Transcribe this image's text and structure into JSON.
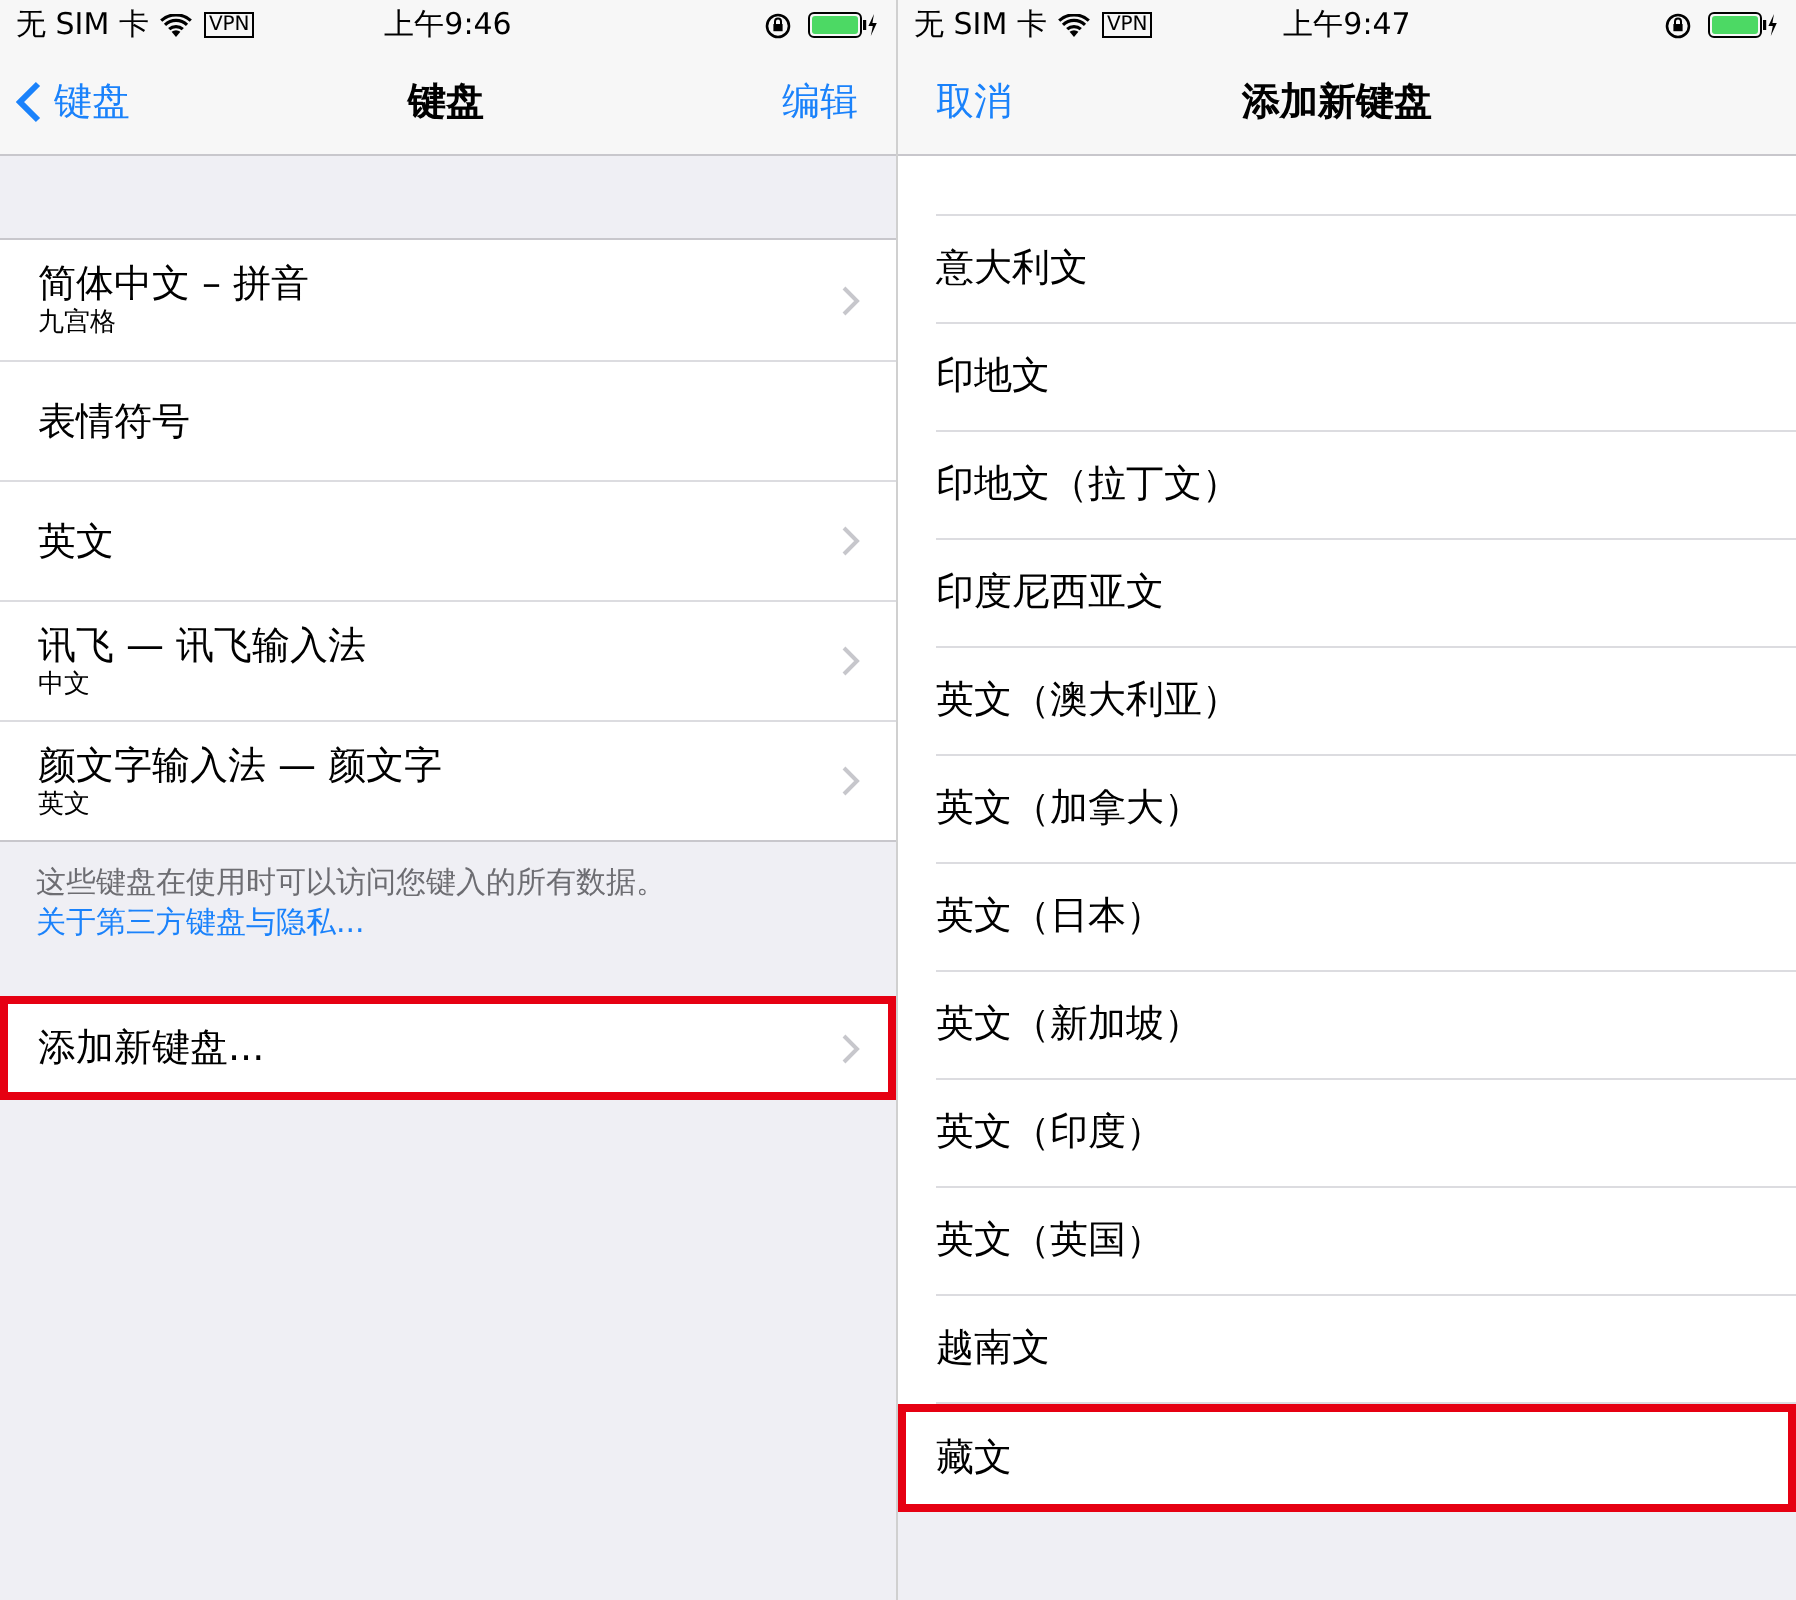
{
  "screens": [
    {
      "status_bar": {
        "carrier": "无 SIM 卡",
        "vpn": "VPN",
        "time": "上午9:46"
      },
      "nav": {
        "back": "键盘",
        "title": "键盘",
        "action": "编辑"
      },
      "keyboards": [
        {
          "title": "简体中文 – 拼音",
          "subtitle": "九宫格",
          "chevron": true
        },
        {
          "title": "表情符号",
          "chevron": false
        },
        {
          "title": "英文",
          "chevron": true
        },
        {
          "title": "讯飞 — 讯飞输入法",
          "subtitle": "中文",
          "chevron": true
        },
        {
          "title": "颜文字输入法 — 颜文字",
          "subtitle": "英文",
          "chevron": true
        }
      ],
      "footer": {
        "text": "这些键盘在使用时可以访问您键入的所有数据。",
        "link": "关于第三方键盘与隐私..."
      },
      "add_row": {
        "title": "添加新键盘...",
        "chevron": true,
        "highlighted": true
      }
    },
    {
      "status_bar": {
        "carrier": "无 SIM 卡",
        "vpn": "VPN",
        "time": "上午9:47"
      },
      "nav": {
        "cancel": "取消",
        "title": "添加新键盘"
      },
      "languages": [
        {
          "title": "意大利文",
          "highlighted": false
        },
        {
          "title": "印地文",
          "highlighted": false
        },
        {
          "title": "印地文（拉丁文）",
          "highlighted": false
        },
        {
          "title": "印度尼西亚文",
          "highlighted": false
        },
        {
          "title": "英文（澳大利亚）",
          "highlighted": false
        },
        {
          "title": "英文（加拿大）",
          "highlighted": false
        },
        {
          "title": "英文（日本）",
          "highlighted": false
        },
        {
          "title": "英文（新加坡）",
          "highlighted": false
        },
        {
          "title": "英文（印度）",
          "highlighted": false
        },
        {
          "title": "英文（英国）",
          "highlighted": false
        },
        {
          "title": "越南文",
          "highlighted": false
        },
        {
          "title": "藏文",
          "highlighted": true
        }
      ]
    }
  ]
}
